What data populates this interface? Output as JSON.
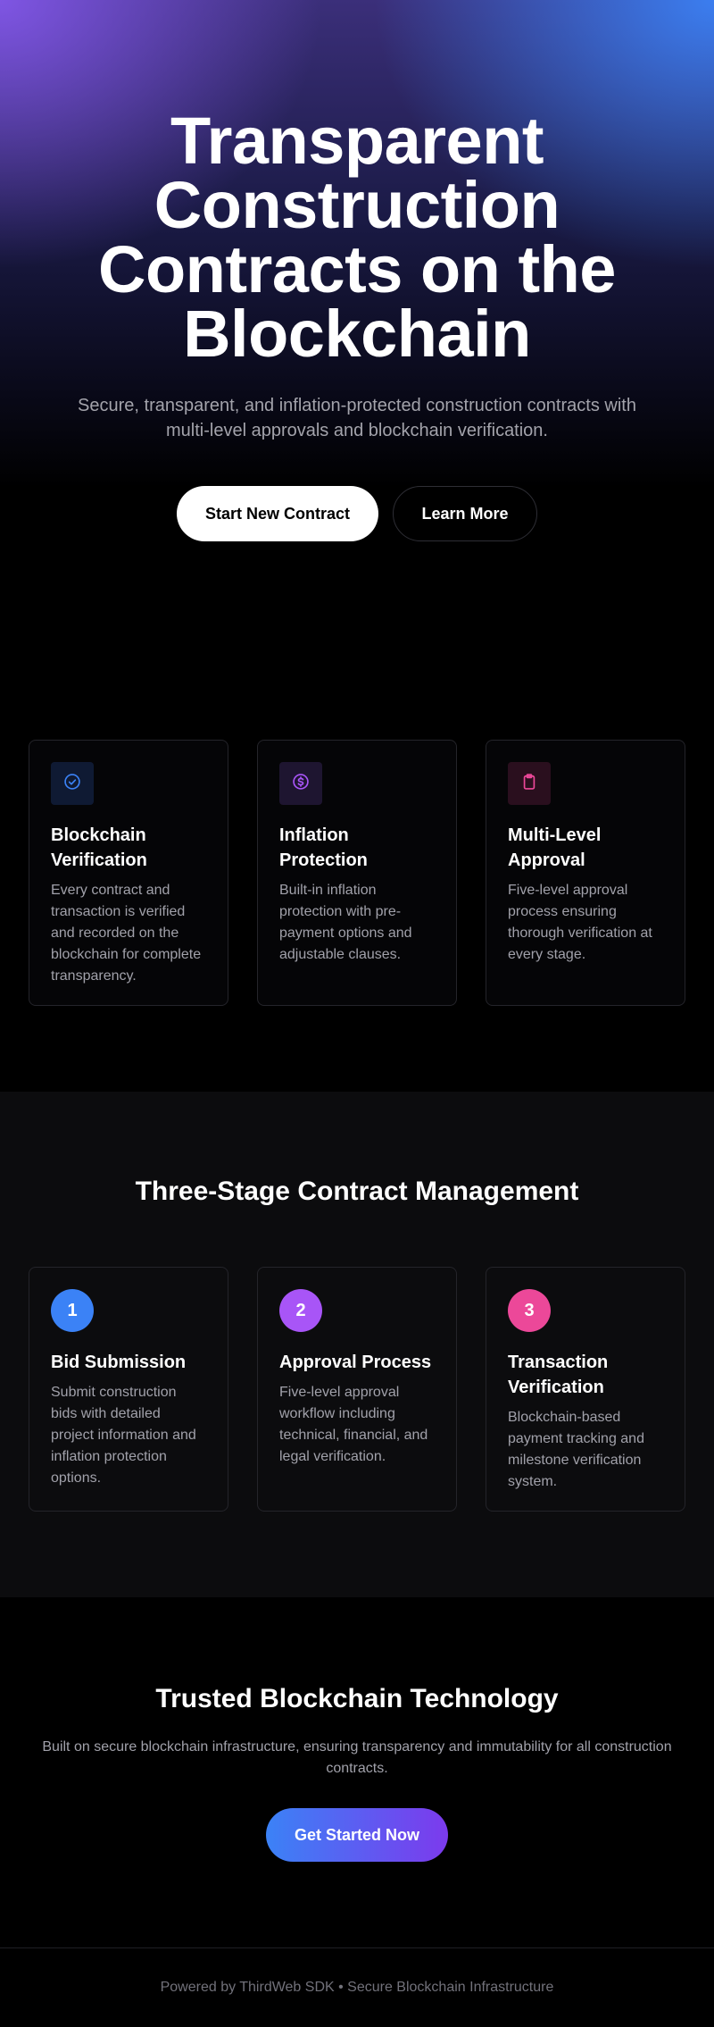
{
  "hero": {
    "title": "Transparent Construction Contracts on the Blockchain",
    "subtitle": "Secure, transparent, and inflation-protected construction contracts with multi-level approvals and blockchain verification.",
    "primary_button": "Start New Contract",
    "secondary_button": "Learn More"
  },
  "features": [
    {
      "icon": "check-circle-icon",
      "icon_color": "#3b82f6",
      "icon_bg": "#0f1a33",
      "title": "Blockchain Verification",
      "description": "Every contract and transaction is verified and recorded on the blockchain for complete transparency."
    },
    {
      "icon": "dollar-circle-icon",
      "icon_color": "#a855f7",
      "icon_bg": "#1e1530",
      "title": "Inflation Protection",
      "description": "Built-in inflation protection with pre-payment options and adjustable clauses."
    },
    {
      "icon": "clipboard-icon",
      "icon_color": "#ec4899",
      "icon_bg": "#2a0f1e",
      "title": "Multi-Level Approval",
      "description": "Five-level approval process ensuring thorough verification at every stage."
    }
  ],
  "stages": {
    "title": "Three-Stage Contract Management",
    "items": [
      {
        "number": "1",
        "color": "#3b82f6",
        "title": "Bid Submission",
        "description": "Submit construction bids with detailed project information and inflation protection options."
      },
      {
        "number": "2",
        "color": "#a855f7",
        "title": "Approval Process",
        "description": "Five-level approval workflow including technical, financial, and legal verification."
      },
      {
        "number": "3",
        "color": "#ec4899",
        "title": "Transaction Verification",
        "description": "Blockchain-based payment tracking and milestone verification system."
      }
    ]
  },
  "trust": {
    "title": "Trusted Blockchain Technology",
    "subtitle": "Built on secure blockchain infrastructure, ensuring transparency and immutability for all construction contracts.",
    "button": "Get Started Now"
  },
  "footer": {
    "text": "Powered by ThirdWeb SDK • Secure Blockchain Infrastructure"
  }
}
